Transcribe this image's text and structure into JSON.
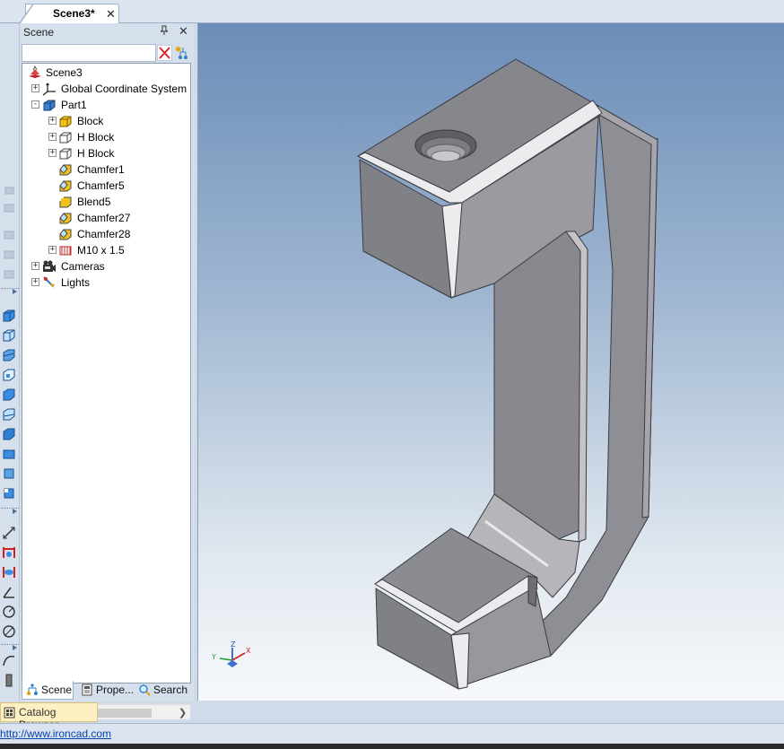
{
  "document_tab": {
    "label": "Scene3*",
    "close": "✕"
  },
  "scene_panel": {
    "title": "Scene",
    "pin_glyph": "📌",
    "close_glyph": "✕",
    "search": {
      "value": "",
      "placeholder": ""
    },
    "tree": [
      {
        "label": "Scene3",
        "icon": "scene-icon",
        "expander": ""
      },
      {
        "label": "Global Coordinate System",
        "icon": "coordinate-system-icon",
        "expander": "+"
      },
      {
        "label": "Part1",
        "icon": "part-icon",
        "expander": "-"
      },
      {
        "label": "Block",
        "icon": "block-icon",
        "expander": "+"
      },
      {
        "label": "H Block",
        "icon": "hole-block-icon",
        "expander": "+"
      },
      {
        "label": "H Block",
        "icon": "hole-block-icon",
        "expander": "+"
      },
      {
        "label": "Chamfer1",
        "icon": "chamfer-icon",
        "expander": ""
      },
      {
        "label": "Chamfer5",
        "icon": "chamfer-icon",
        "expander": ""
      },
      {
        "label": "Blend5",
        "icon": "blend-icon",
        "expander": ""
      },
      {
        "label": "Chamfer27",
        "icon": "chamfer-icon",
        "expander": ""
      },
      {
        "label": "Chamfer28",
        "icon": "chamfer-icon",
        "expander": ""
      },
      {
        "label": "M10 x 1.5",
        "icon": "thread-icon",
        "expander": "+"
      },
      {
        "label": "Cameras",
        "icon": "camera-icon",
        "expander": "+"
      },
      {
        "label": "Lights",
        "icon": "light-icon",
        "expander": "+"
      }
    ],
    "bottom_tabs": [
      {
        "label": "Scene",
        "icon": "scene-tree-icon"
      },
      {
        "label": "Prope...",
        "icon": "properties-icon"
      },
      {
        "label": "Search",
        "icon": "search-icon"
      }
    ]
  },
  "viewport": {
    "triad": {
      "x": "X",
      "y": "Y",
      "z": "Z"
    }
  },
  "catalog_browser": {
    "label": "Catalog Browser"
  },
  "status_bar": {
    "link": "http://www.ironcad.com"
  },
  "colors": {
    "frame": "#d6e0ec",
    "viewport_top": "#6b8db8",
    "viewport_bottom": "#f7f9fb",
    "model_gray": "#8a8a90",
    "catalog_tab": "#fdf1c4",
    "link": "#0645ad"
  }
}
